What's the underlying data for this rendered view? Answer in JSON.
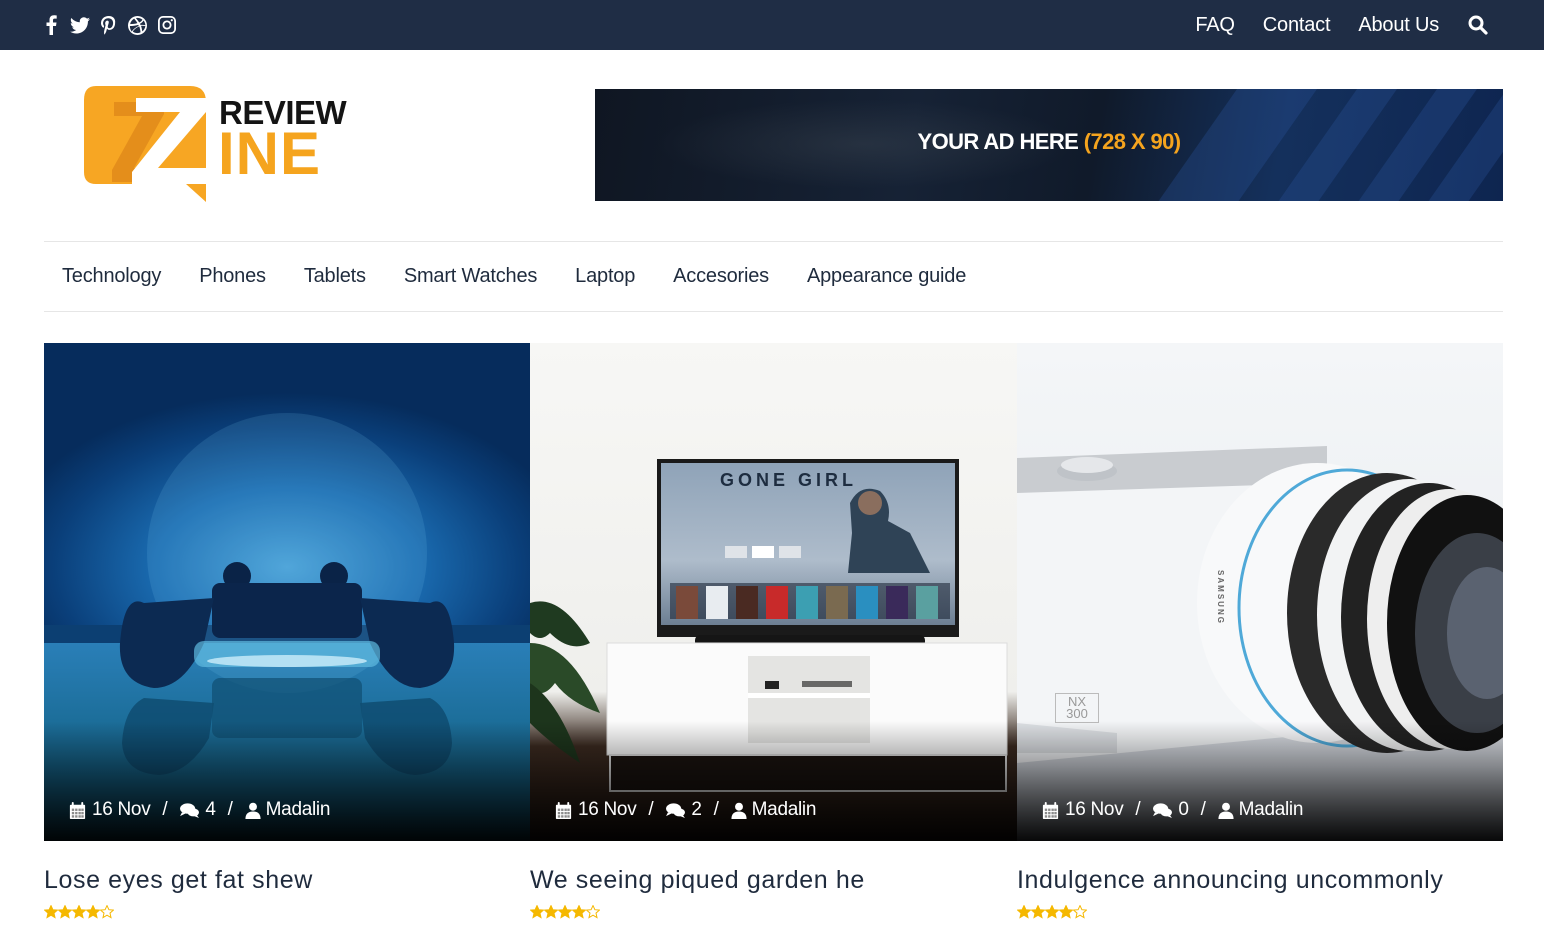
{
  "topbar": {
    "social": [
      {
        "name": "facebook-icon",
        "label": "Facebook"
      },
      {
        "name": "twitter-icon",
        "label": "Twitter"
      },
      {
        "name": "pinterest-icon",
        "label": "Pinterest"
      },
      {
        "name": "dribbble-icon",
        "label": "Dribbble"
      },
      {
        "name": "instagram-icon",
        "label": "Instagram"
      }
    ],
    "links": [
      "FAQ",
      "Contact",
      "About Us"
    ],
    "search_icon": "search-icon"
  },
  "header": {
    "logo": {
      "line1": "REVIEW",
      "line2": "INE",
      "mark": "Z"
    },
    "ad": {
      "text_white": "YOUR AD HERE ",
      "text_orange": "(728 X 90)"
    }
  },
  "colors": {
    "topbar": "#1f2d45",
    "accent": "#f5a41e",
    "text": "#1f2b3d",
    "star": "#f5b800"
  },
  "categories": [
    "Technology",
    "Phones",
    "Tablets",
    "Smart Watches",
    "Laptop",
    "Accesories",
    "Appearance guide"
  ],
  "posts": [
    {
      "date": "16 Nov",
      "comments": "4",
      "author": "Madalin",
      "title": "Lose eyes get fat shew",
      "rating": 4,
      "rating_max": 5,
      "image": "game controller on reflective surface"
    },
    {
      "date": "16 Nov",
      "comments": "2",
      "author": "Madalin",
      "title": "We seeing piqued garden he",
      "rating": 4,
      "rating_max": 5,
      "image": "TV on white media console showing Gone Girl",
      "tv_screen_title": "GONE GIRL"
    },
    {
      "date": "16 Nov",
      "comments": "0",
      "author": "Madalin",
      "title": "Indulgence announcing uncommonly",
      "rating": 4,
      "rating_max": 5,
      "image": "white Samsung NX300 camera",
      "camera_brand": "SAMSUNG",
      "camera_model": "NX 300"
    }
  ],
  "meta_separator": "/"
}
